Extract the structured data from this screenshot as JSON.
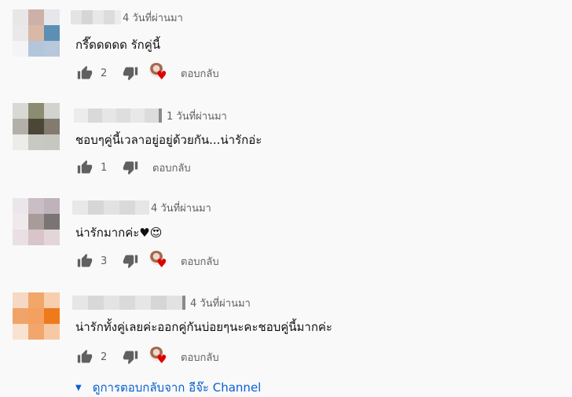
{
  "colors": {
    "text": "#0f0f0f",
    "secondary": "#606060",
    "link": "#065fd4",
    "heart": "#e00000",
    "background": "#f9f9f9"
  },
  "icons": {
    "like": "thumbs-up-icon",
    "dislike": "thumbs-down-icon",
    "creator_heart": "creator-heart-icon",
    "expand": "caret-down-icon"
  },
  "comments": [
    {
      "time": "4 วันที่ผ่านมา",
      "text": "กรี๊ดดดดด รักคู่นี้",
      "likes": "2",
      "reply_label": "ตอบกลับ",
      "hearted": true
    },
    {
      "time": "1 วันที่ผ่านมา",
      "text": "ชอบๆคู่นี้เวลาอยู่อยู่ด้วยกัน...น่ารักอ่ะ",
      "likes": "1",
      "reply_label": "ตอบกลับ",
      "hearted": false
    },
    {
      "time": "4 วันที่ผ่านมา",
      "text": "น่ารักมากค่ะ♥😍",
      "likes": "3",
      "reply_label": "ตอบกลับ",
      "hearted": true
    },
    {
      "time": "4 วันที่ผ่านมา",
      "text": "น่ารักทั้งคู่เลยค่ะออกคู่กันบ่อยๆนะคะชอบคู่นี้มากค่ะ",
      "likes": "2",
      "reply_label": "ตอบกลับ",
      "hearted": true
    }
  ],
  "view_replies": {
    "label": "ดูการตอบกลับจาก อีจ๊ะ Channel"
  }
}
